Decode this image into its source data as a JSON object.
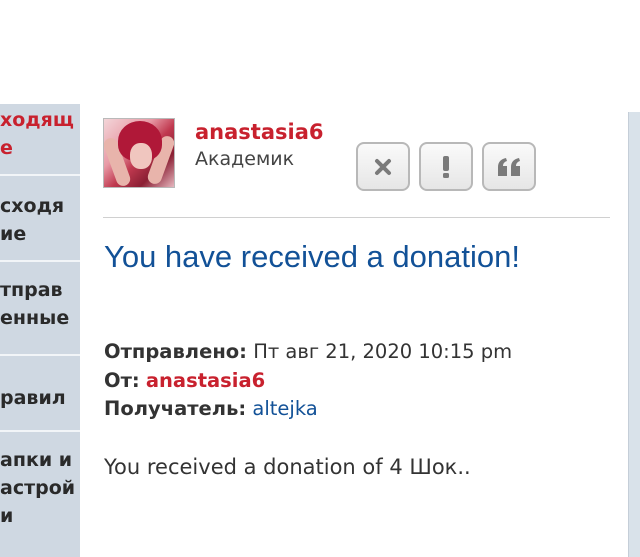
{
  "sidebar": {
    "items": [
      {
        "label": "ходящ\nе",
        "active": true
      },
      {
        "label": "сходя\nие",
        "active": false
      },
      {
        "label": "тправ\nенные",
        "active": false
      },
      {
        "label": "равил",
        "active": false
      },
      {
        "label": "апки и\nастрой\nи",
        "active": false
      }
    ]
  },
  "post": {
    "author": "anastasia6",
    "rank": "Академик",
    "subject": "You have received a donation!",
    "sent_label": "Отправлено:",
    "sent_value": "Пт авг 21, 2020 10:15 pm",
    "from_label": "От:",
    "from_value": "anastasia6",
    "recipient_label": "Получатель:",
    "recipient_value": "altejka",
    "content": "You received a donation of 4 Шок.."
  },
  "buttons": {
    "delete_icon": "close-icon",
    "report_icon": "exclamation-icon",
    "quote_icon": "quote-icon"
  },
  "colors": {
    "author": "#c8212e",
    "subject": "#125197",
    "sidebar_bg": "#cfd8e2"
  }
}
